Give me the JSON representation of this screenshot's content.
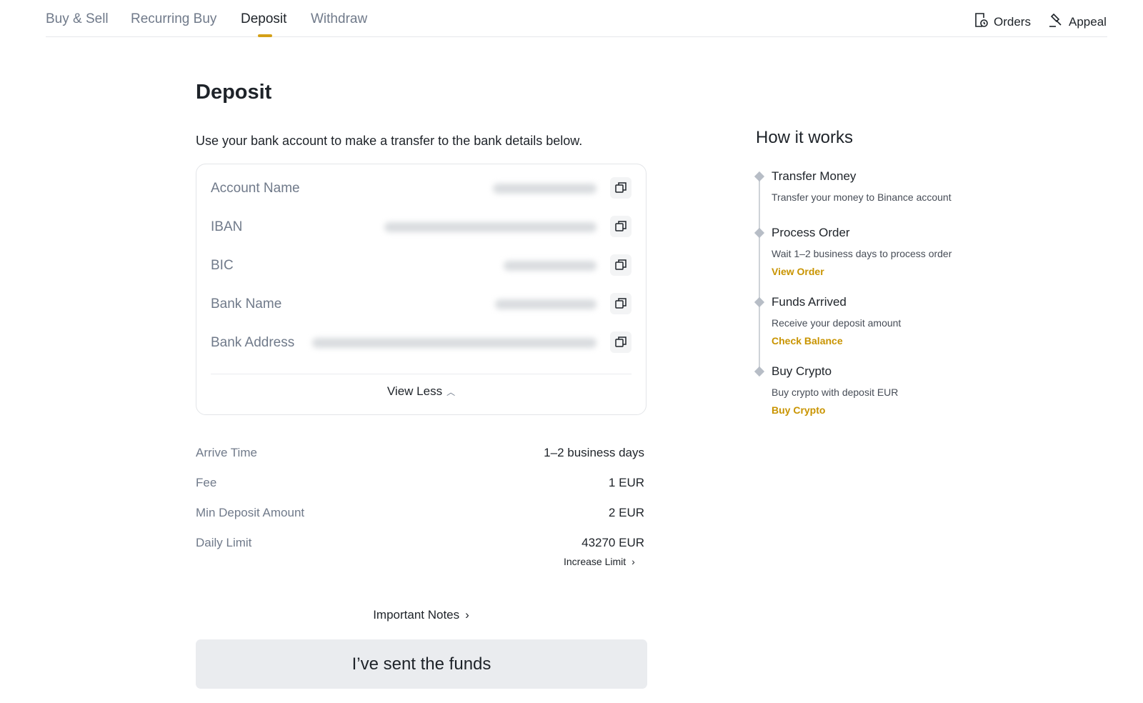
{
  "nav": {
    "tabs": [
      {
        "label": "Buy & Sell"
      },
      {
        "label": "Recurring Buy"
      },
      {
        "label": "Deposit"
      },
      {
        "label": "Withdraw"
      }
    ],
    "active_tab": "Deposit",
    "orders_label": "Orders",
    "appeal_label": "Appeal"
  },
  "deposit": {
    "title": "Deposit",
    "intro": "Use your bank account to make a transfer to the bank details below.",
    "bank_fields": [
      {
        "label": "Account Name"
      },
      {
        "label": "IBAN"
      },
      {
        "label": "BIC"
      },
      {
        "label": "Bank Name"
      },
      {
        "label": "Bank Address"
      }
    ],
    "view_less_label": "View Less",
    "info": [
      {
        "label": "Arrive Time",
        "value": "1–2 business days"
      },
      {
        "label": "Fee",
        "value": "1 EUR"
      },
      {
        "label": "Min Deposit Amount",
        "value": "2 EUR"
      },
      {
        "label": "Daily Limit",
        "value": "43270 EUR"
      }
    ],
    "increase_limit_label": "Increase Limit",
    "important_notes_label": "Important Notes",
    "sent_button_label": "I’ve sent the funds"
  },
  "how_it_works": {
    "title": "How it works",
    "steps": [
      {
        "title": "Transfer Money",
        "desc": "Transfer your money to Binance account",
        "link": ""
      },
      {
        "title": "Process Order",
        "desc": "Wait 1–2 business days to process order",
        "link": "View Order"
      },
      {
        "title": "Funds Arrived",
        "desc": "Receive your deposit amount",
        "link": "Check Balance"
      },
      {
        "title": "Buy Crypto",
        "desc": "Buy crypto with deposit EUR",
        "link": "Buy Crypto"
      }
    ]
  },
  "colors": {
    "accent": "#d4a017",
    "link": "#c99400",
    "muted_text": "#707a8a",
    "primary_text": "#1e2329",
    "button_bg": "#eaecef"
  }
}
